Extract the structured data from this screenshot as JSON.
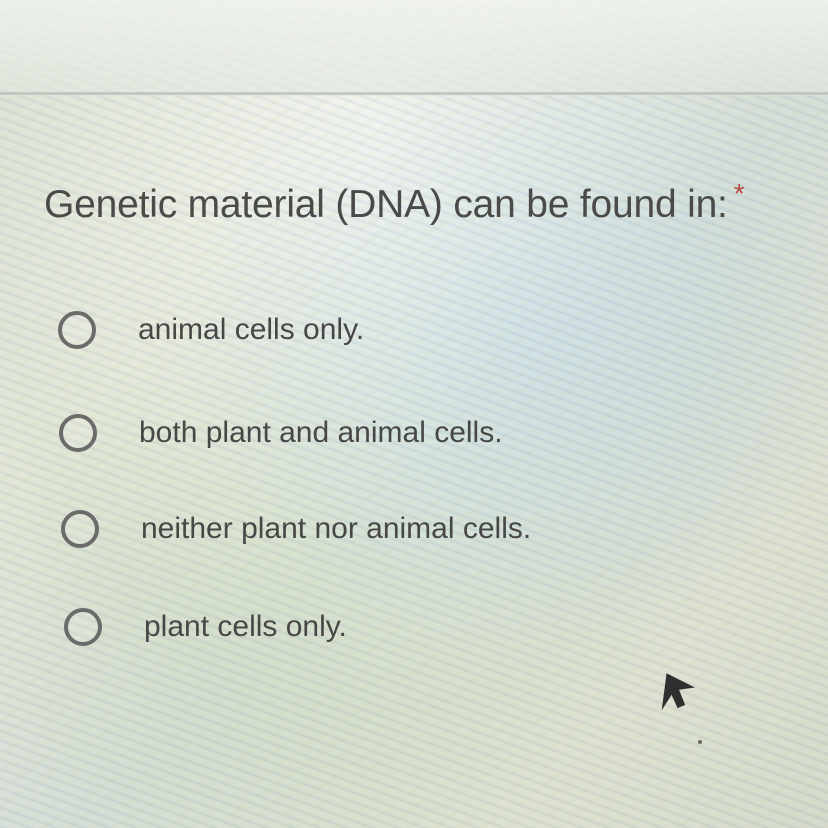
{
  "question": {
    "text": "Genetic material (DNA) can be found in:",
    "required_marker": "*"
  },
  "options": [
    {
      "label": "animal cells only.",
      "selected": false
    },
    {
      "label": "both plant and animal cells.",
      "selected": false
    },
    {
      "label": "neither plant nor animal cells.",
      "selected": false
    },
    {
      "label": "plant cells only.",
      "selected": false
    }
  ],
  "icons": {
    "radio": "radio-button-empty-icon",
    "pointer": "mouse-pointer-icon"
  },
  "colors": {
    "text": "#474846",
    "radio_border": "#6b6c6a",
    "required_marker": "#b84a44"
  }
}
